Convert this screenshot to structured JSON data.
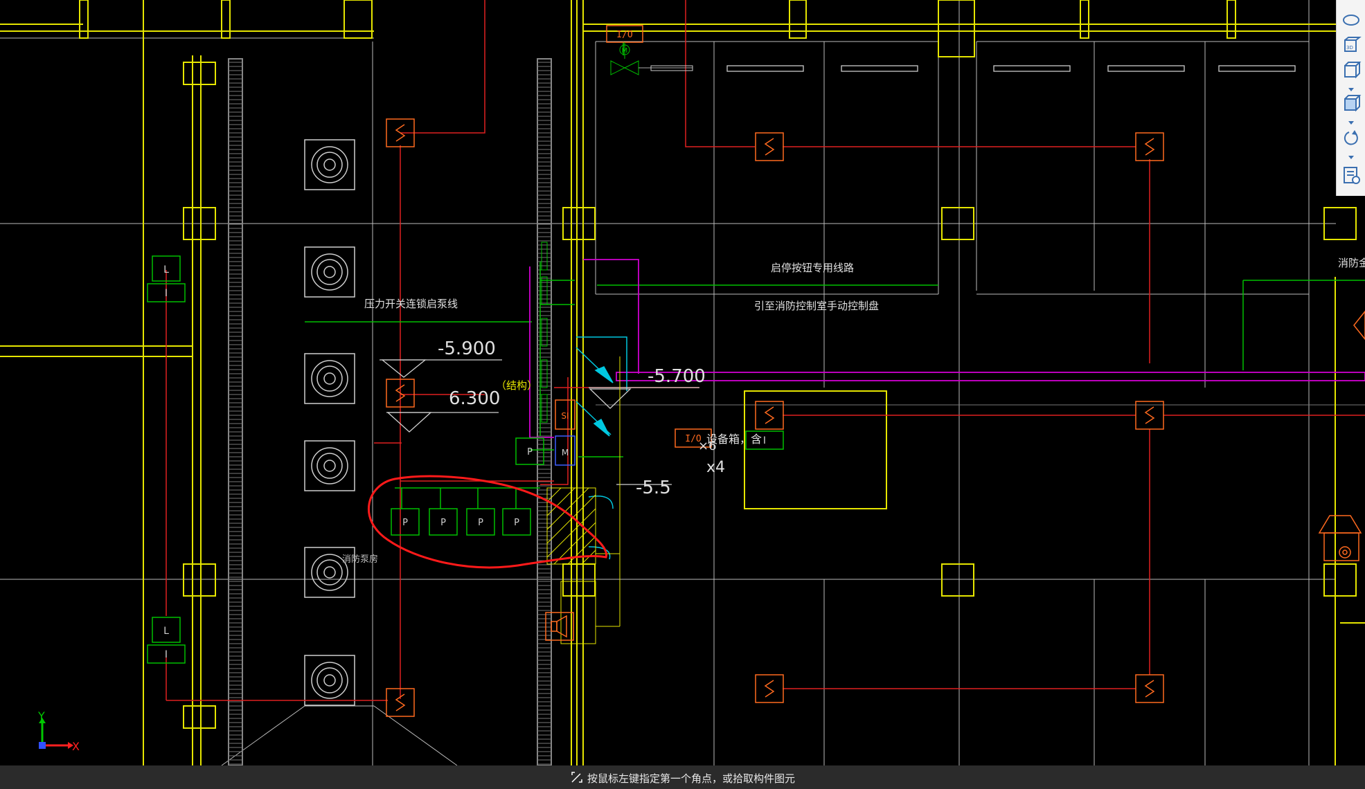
{
  "drawing": {
    "labels": {
      "pressure_switch_line": "压力开关连锁启泵线",
      "start_stop_line": "启停按钮专用线路",
      "to_control_panel": "引至消防控制室手动控制盘",
      "fire_right": "消防金",
      "pump_room": "消防泵房",
      "structure": "（结构）",
      "box_note": "设备箱，含",
      "box_count": "x4",
      "box_sub": "×6"
    },
    "elevations": {
      "e1": "-5.900",
      "e2": "6.300",
      "e3": "-5.700",
      "e4": "-5.5"
    },
    "symbols": {
      "io": "I/O",
      "motor": "M",
      "pump": "P",
      "level": "L",
      "input": "I",
      "si": "SI"
    },
    "axis": {
      "x": "X",
      "y": "Y"
    },
    "colors": {
      "background": "#000000",
      "wall": "#e6e600",
      "grid": "#c8c8c8",
      "power_line": "#e02020",
      "signal_line": "#00c000",
      "device": "#ff6a1f",
      "magenta": "#d000d0",
      "cyan": "#00c8e0",
      "annotation": "#ff1a1a"
    }
  },
  "toolbar": {
    "items": [
      "orbit-icon",
      "3d-view-icon",
      "cube-view-icon",
      "solid-cube-icon",
      "rotate-icon",
      "layer-props-icon"
    ]
  },
  "statusbar": {
    "prompt": "按鼠标左键指定第一个角点，或拾取构件图元"
  }
}
